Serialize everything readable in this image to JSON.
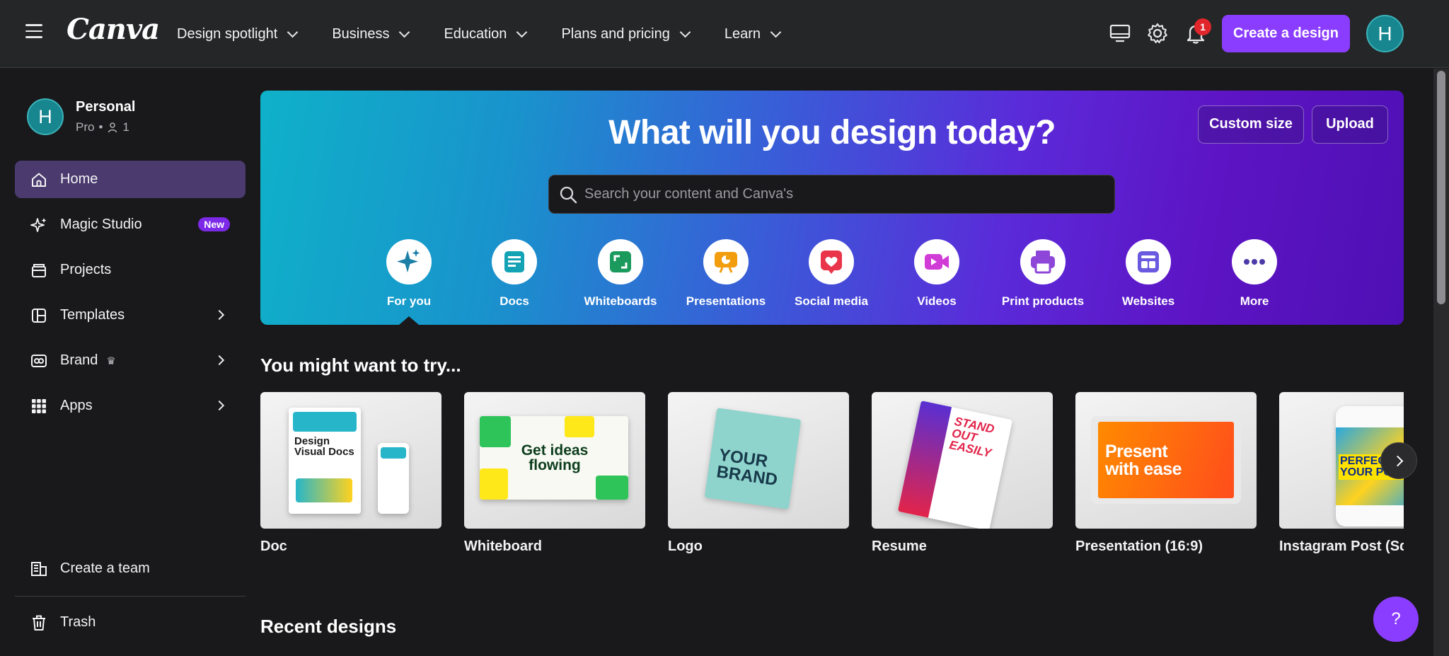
{
  "topbar": {
    "logo": "Canva",
    "nav": [
      {
        "label": "Design spotlight"
      },
      {
        "label": "Business"
      },
      {
        "label": "Education"
      },
      {
        "label": "Plans and pricing"
      },
      {
        "label": "Learn"
      }
    ],
    "notification_count": "1",
    "create_label": "Create a design",
    "avatar_initial": "H"
  },
  "sidebar": {
    "account": {
      "initial": "H",
      "name": "Personal",
      "plan": "Pro",
      "members": "1"
    },
    "items": [
      {
        "label": "Home",
        "icon": "home-icon"
      },
      {
        "label": "Magic Studio",
        "icon": "sparkle-icon",
        "badge": "New"
      },
      {
        "label": "Projects",
        "icon": "folder-icon"
      },
      {
        "label": "Templates",
        "icon": "templates-icon"
      },
      {
        "label": "Brand",
        "icon": "brand-icon"
      },
      {
        "label": "Apps",
        "icon": "apps-grid-icon"
      }
    ],
    "bottom": [
      {
        "label": "Create a team",
        "icon": "team-icon"
      },
      {
        "label": "Trash",
        "icon": "trash-icon"
      }
    ]
  },
  "hero": {
    "title": "What will you design today?",
    "custom_size": "Custom size",
    "upload": "Upload",
    "search_placeholder": "Search your content and Canva's",
    "categories": [
      {
        "label": "For you",
        "icon": "sparkle-icon",
        "color": "#1c7fa6"
      },
      {
        "label": "Docs",
        "icon": "docs-icon",
        "color": "#13a3b5"
      },
      {
        "label": "Whiteboards",
        "icon": "whiteboard-icon",
        "color": "#1a9a5c"
      },
      {
        "label": "Presentations",
        "icon": "presentation-icon",
        "color": "#f29d0e"
      },
      {
        "label": "Social media",
        "icon": "heart-icon",
        "color": "#e9344a"
      },
      {
        "label": "Videos",
        "icon": "video-icon",
        "color": "#d13bd6"
      },
      {
        "label": "Print products",
        "icon": "printer-icon",
        "color": "#8d46d8"
      },
      {
        "label": "Websites",
        "icon": "website-icon",
        "color": "#6a5ae0"
      },
      {
        "label": "More",
        "icon": "more-icon",
        "color": "#4b3aa8"
      }
    ]
  },
  "suggestions": {
    "title": "You might want to try...",
    "cards": [
      {
        "label": "Doc",
        "art": "Design Visual Docs"
      },
      {
        "label": "Whiteboard",
        "art": "Get ideas flowing"
      },
      {
        "label": "Logo",
        "art": "YOUR BRAND"
      },
      {
        "label": "Resume",
        "art": "STAND OUT EASILY"
      },
      {
        "label": "Presentation (16:9)",
        "art": "Present with ease"
      },
      {
        "label": "Instagram Post (Squ",
        "art": "PERFECT YOUR PO"
      }
    ]
  },
  "recent": {
    "title": "Recent designs"
  },
  "help_label": "?"
}
